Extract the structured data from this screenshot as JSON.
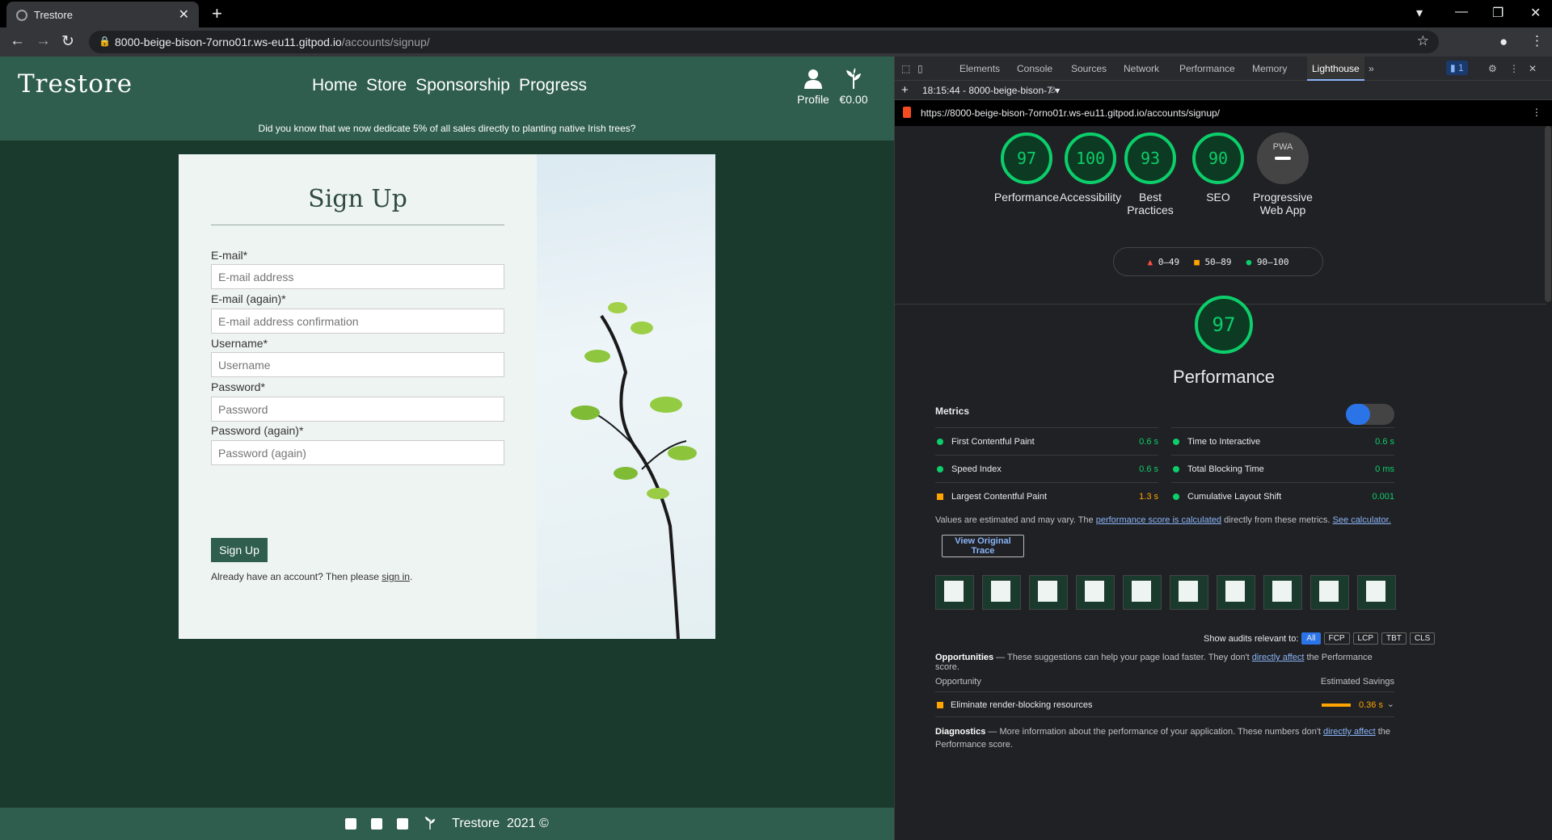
{
  "browser": {
    "tab_title": "Trestore",
    "url_host": "8000-beige-bison-7orno01r.ws-eu11.gitpod.io",
    "url_path": "/accounts/signup/"
  },
  "site": {
    "brand": "Trestore",
    "nav": [
      "Home",
      "Store",
      "Sponsorship",
      "Progress"
    ],
    "profile_label": "Profile",
    "bag_total": "€0.00",
    "banner": "Did you know that we now dedicate 5% of all sales directly to planting native Irish trees?",
    "footer_text": "Trestore  2021 ©"
  },
  "signup": {
    "heading": "Sign Up",
    "fields": [
      {
        "label": "E-mail*",
        "placeholder": "E-mail address"
      },
      {
        "label": "E-mail (again)*",
        "placeholder": "E-mail address confirmation"
      },
      {
        "label": "Username*",
        "placeholder": "Username"
      },
      {
        "label": "Password*",
        "placeholder": "Password"
      },
      {
        "label": "Password (again)*",
        "placeholder": "Password (again)"
      }
    ],
    "submit": "Sign Up",
    "already_text": "Already have an account? Then please",
    "signin_link": "sign in",
    "period": "."
  },
  "devtools": {
    "tabs": [
      "Elements",
      "Console",
      "Sources",
      "Network",
      "Performance",
      "Memory",
      "Lighthouse"
    ],
    "issues_badge": "1",
    "report_selector": "18:15:44 - 8000-beige-bison-7",
    "report_url": "https://8000-beige-bison-7orno01r.ws-eu11.gitpod.io/accounts/signup/",
    "scores": [
      {
        "value": "97",
        "label": "Performance"
      },
      {
        "value": "100",
        "label": "Accessibility"
      },
      {
        "value": "93",
        "label": "Best Practices"
      },
      {
        "value": "90",
        "label": "SEO"
      }
    ],
    "pwa": {
      "badge": "PWA",
      "label": "Progressive Web App"
    },
    "legend": [
      "0–49",
      "50–89",
      "90–100"
    ],
    "perf_score": "97",
    "perf_title": "Performance",
    "metrics_heading": "Metrics",
    "metrics": [
      {
        "name": "First Contentful Paint",
        "value": "0.6 s",
        "status": "pass"
      },
      {
        "name": "Time to Interactive",
        "value": "0.6 s",
        "status": "pass"
      },
      {
        "name": "Speed Index",
        "value": "0.6 s",
        "status": "pass"
      },
      {
        "name": "Total Blocking Time",
        "value": "0 ms",
        "status": "pass"
      },
      {
        "name": "Largest Contentful Paint",
        "value": "1.3 s",
        "status": "average"
      },
      {
        "name": "Cumulative Layout Shift",
        "value": "0.001",
        "status": "pass"
      }
    ],
    "values_note": {
      "a": "Values are estimated and may vary. The ",
      "link1": "performance score is calculated",
      "b": " directly from these metrics. ",
      "link2": "See calculator."
    },
    "view_trace": "View Original Trace",
    "show_audits_label": "Show audits relevant to:",
    "audit_filters": [
      "All",
      "FCP",
      "LCP",
      "TBT",
      "CLS"
    ],
    "opportunities": {
      "title": "Opportunities",
      "text": " — These suggestions can help your page load faster. They don't ",
      "link": "directly affect",
      "tail": " the Performance score.",
      "col_left": "Opportunity",
      "col_right": "Estimated Savings",
      "item": "Eliminate render-blocking resources",
      "savings": "0.36 s"
    },
    "diagnostics": {
      "title": "Diagnostics",
      "text": " — More information about the performance of your application. These numbers don't ",
      "link": "directly affect",
      "tail": " the Performance score."
    },
    "colors": {
      "pass": "#0cce6b",
      "average": "#ffa400",
      "fail": "#ff4e42"
    }
  }
}
